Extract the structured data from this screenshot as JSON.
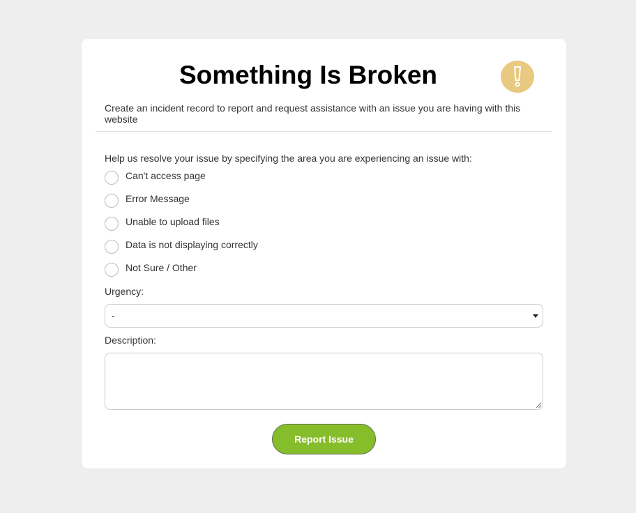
{
  "header": {
    "title": "Something Is Broken",
    "icon": "exclamation-icon",
    "icon_color": "#e8c97f",
    "subtitle": "Create an incident record to report and request assistance with an issue you are having with this website"
  },
  "form": {
    "prompt": "Help us resolve your issue by specifying the area you are experiencing an issue with:",
    "options": [
      {
        "label": "Can't access page"
      },
      {
        "label": "Error Message"
      },
      {
        "label": "Unable to upload files"
      },
      {
        "label": "Data is not displaying correctly"
      },
      {
        "label": "Not Sure / Other"
      }
    ],
    "urgency_label": "Urgency:",
    "urgency_value": "-",
    "description_label": "Description:",
    "description_value": "",
    "submit_label": "Report Issue",
    "submit_color": "#86bd2b"
  }
}
